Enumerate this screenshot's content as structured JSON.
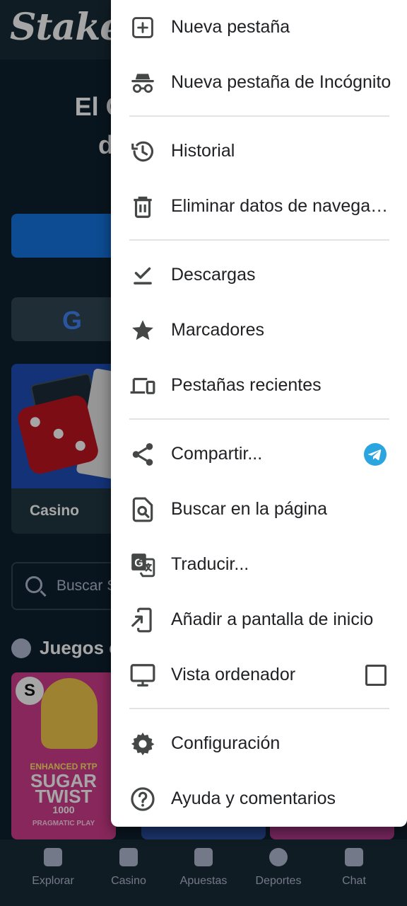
{
  "background_page": {
    "logo": "Stake",
    "hero_line1": "El Casino y Apuestas",
    "hero_line2": "deportivas online",
    "casino_card_label": "Casino",
    "search_placeholder": "Buscar Stake",
    "section_title": "Juegos en tendencia",
    "game1": {
      "tag": "ENHANCED RTP",
      "title_line1": "SUGAR",
      "title_line2": "TWIST",
      "title_line3": "1000",
      "provider": "PRAGMATIC PLAY"
    },
    "bottom_nav": [
      {
        "label": "Explorar",
        "icon": "explore-icon"
      },
      {
        "label": "Casino",
        "icon": "casino-icon"
      },
      {
        "label": "Apuestas",
        "icon": "bets-icon"
      },
      {
        "label": "Deportes",
        "icon": "sports-icon"
      },
      {
        "label": "Chat",
        "icon": "chat-icon"
      }
    ]
  },
  "menu": {
    "items": [
      {
        "label": "Nueva pestaña",
        "icon": "new-tab-icon"
      },
      {
        "label": "Nueva pestaña de Incógnito",
        "icon": "incognito-icon"
      },
      {
        "label": "Historial",
        "icon": "history-icon"
      },
      {
        "label": "Eliminar datos de navegación",
        "icon": "trash-icon"
      },
      {
        "label": "Descargas",
        "icon": "downloads-icon"
      },
      {
        "label": "Marcadores",
        "icon": "star-icon"
      },
      {
        "label": "Pestañas recientes",
        "icon": "devices-icon"
      },
      {
        "label": "Compartir...",
        "icon": "share-icon"
      },
      {
        "label": "Buscar en la página",
        "icon": "find-in-page-icon"
      },
      {
        "label": "Traducir...",
        "icon": "translate-icon"
      },
      {
        "label": "Añadir a pantalla de inicio",
        "icon": "add-to-home-icon"
      },
      {
        "label": "Vista ordenador",
        "icon": "desktop-icon"
      },
      {
        "label": "Configuración",
        "icon": "gear-icon"
      },
      {
        "label": "Ayuda y comentarios",
        "icon": "help-icon"
      }
    ],
    "desktop_view_checked": false,
    "share_target_app_icon": "telegram-icon"
  },
  "colors": {
    "stake_bg": "#0f212e",
    "stake_blue": "#1475e1",
    "menu_text": "#202124",
    "menu_icon": "#444746",
    "telegram": "#2aa5e0"
  }
}
